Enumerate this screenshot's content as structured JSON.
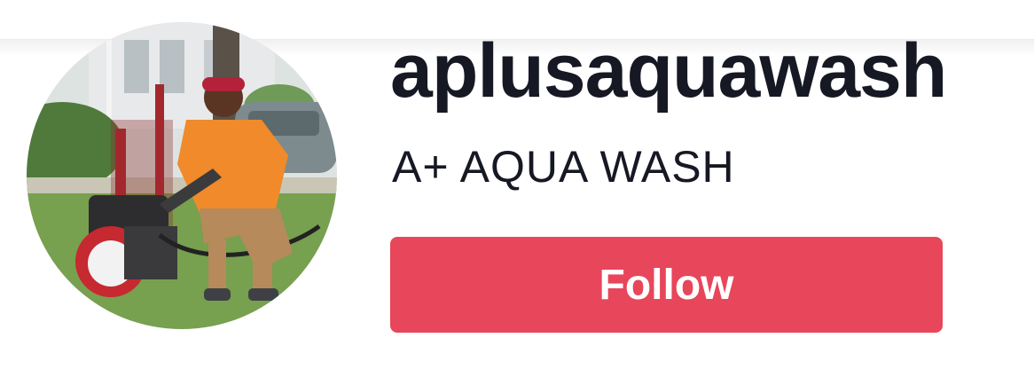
{
  "profile": {
    "username": "aplusaquawash",
    "display_name": "A+ AQUA WASH",
    "avatar_icon": "avatar-photo"
  },
  "actions": {
    "follow_label": "Follow"
  },
  "colors": {
    "follow_button": "#e8465a",
    "text_primary": "#161823"
  }
}
